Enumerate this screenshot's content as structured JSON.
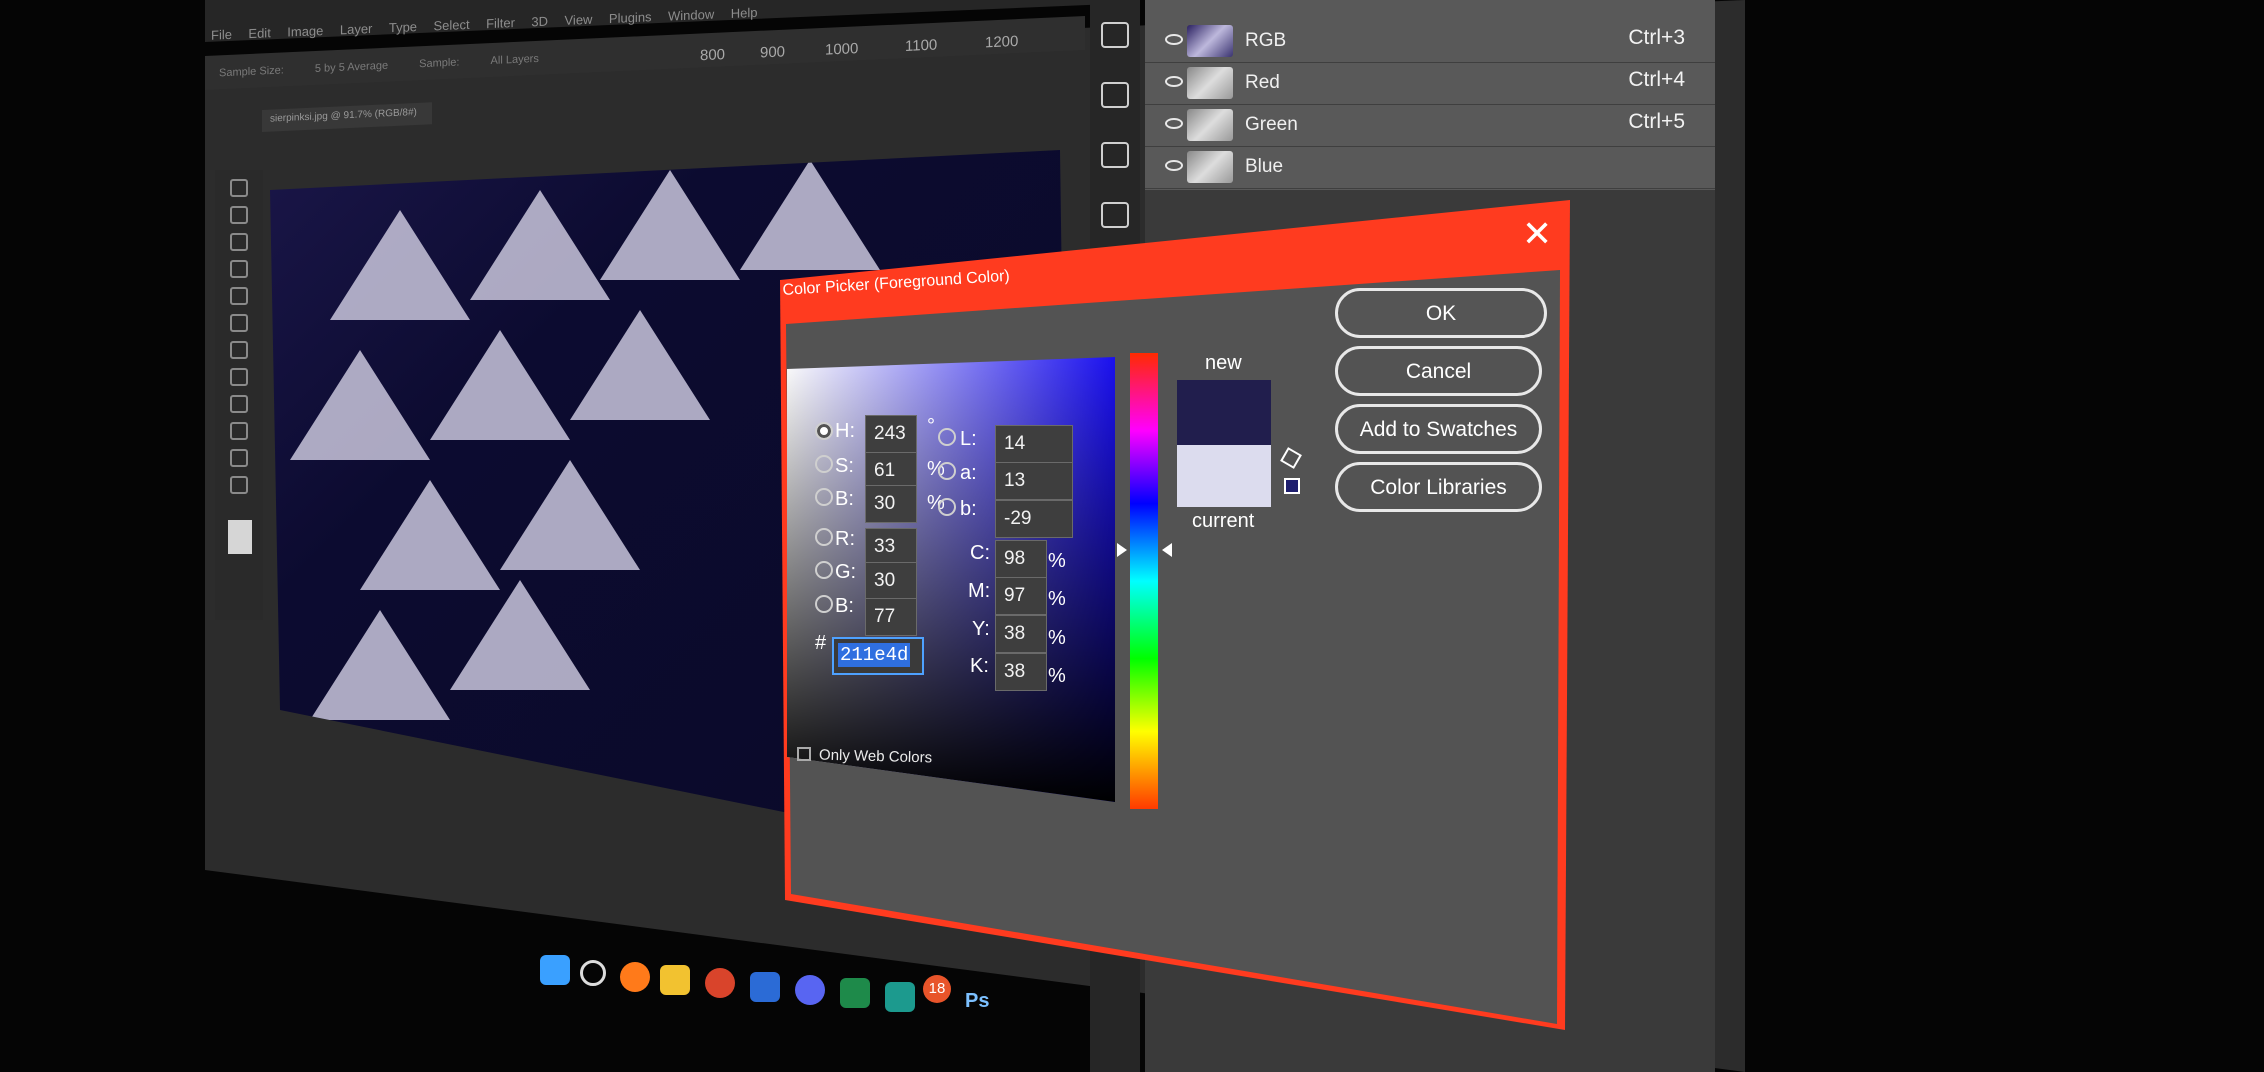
{
  "menubar": {
    "items": [
      "File",
      "Edit",
      "Image",
      "Layer",
      "Type",
      "Select",
      "Filter",
      "3D",
      "View",
      "Plugins",
      "Window",
      "Help"
    ]
  },
  "options_bar": {
    "sample_size_label": "Sample Size:",
    "sample_size_value": "5 by 5 Average",
    "sample_label": "Sample:",
    "sample_value": "All Layers"
  },
  "ruler": {
    "ticks": [
      "800",
      "900",
      "1000",
      "1100",
      "1200"
    ]
  },
  "channels": [
    {
      "name": "RGB",
      "shortcut": "Ctrl+3"
    },
    {
      "name": "Red",
      "shortcut": "Ctrl+4"
    },
    {
      "name": "Green",
      "shortcut": "Ctrl+5"
    },
    {
      "name": "Blue",
      "shortcut": ""
    }
  ],
  "dialog": {
    "title": "Color Picker (Foreground Color)",
    "close_glyph": "✕",
    "buttons": {
      "ok": "OK",
      "cancel": "Cancel",
      "add_to_swatches": "Add to Swatches",
      "color_libraries": "Color Libraries"
    },
    "swatch": {
      "new_label": "new",
      "current_label": "current",
      "new_color": "#211e4d",
      "current_color": "#dcdcee"
    },
    "only_web_colors": "Only Web Colors",
    "hsb": {
      "h": {
        "label": "H:",
        "value": "243",
        "unit": "°"
      },
      "s": {
        "label": "S:",
        "value": "61",
        "unit": "%"
      },
      "b": {
        "label": "B:",
        "value": "30",
        "unit": "%"
      }
    },
    "rgb": {
      "r": {
        "label": "R:",
        "value": "33"
      },
      "g": {
        "label": "G:",
        "value": "30"
      },
      "b": {
        "label": "B:",
        "value": "77"
      }
    },
    "lab": {
      "l": {
        "label": "L:",
        "value": "14"
      },
      "a": {
        "label": "a:",
        "value": "13"
      },
      "b": {
        "label": "b:",
        "value": "-29"
      }
    },
    "cmyk": {
      "c": {
        "label": "C:",
        "value": "98",
        "unit": "%"
      },
      "m": {
        "label": "M:",
        "value": "97",
        "unit": "%"
      },
      "y": {
        "label": "Y:",
        "value": "38",
        "unit": "%"
      },
      "k": {
        "label": "K:",
        "value": "38",
        "unit": "%"
      }
    },
    "hex": {
      "label": "#",
      "value": "211e4d"
    },
    "selected_mode": "H"
  },
  "taskbar": {
    "badge_count": "18",
    "ps_label": "Ps"
  },
  "colors": {
    "accent_frame": "#ff3b1f",
    "dialog_bg": "#535353",
    "hex_selection": "#2f6fe0"
  }
}
